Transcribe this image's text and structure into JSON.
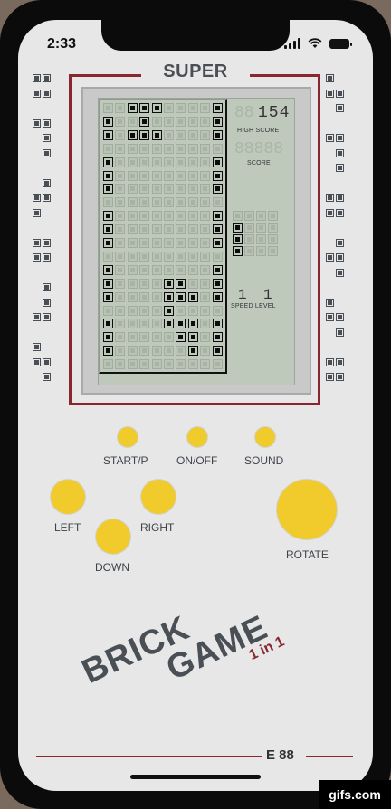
{
  "status": {
    "time": "2:33",
    "wifi_icon": "wifi-icon",
    "signal_icon": "signal-icon",
    "battery_icon": "battery-icon"
  },
  "console": {
    "title": "SUPER",
    "model": "E 88",
    "brand_top": "BRICK",
    "brand_bottom": "GAME",
    "brand_sub": "1 in 1"
  },
  "hud": {
    "high_score": "154",
    "high_score_label": "HIGH SCORE",
    "score": "",
    "score_label": "SCORE",
    "speed_digit": "1",
    "level_digit": "1",
    "speed_level_label": "SPEED LEVEL"
  },
  "board": {
    "cols": 10,
    "rows": 20,
    "on": [
      [
        0,
        2
      ],
      [
        0,
        3
      ],
      [
        0,
        4
      ],
      [
        0,
        9
      ],
      [
        1,
        0
      ],
      [
        1,
        3
      ],
      [
        1,
        9
      ],
      [
        2,
        0
      ],
      [
        2,
        2
      ],
      [
        2,
        3
      ],
      [
        2,
        4
      ],
      [
        2,
        9
      ],
      [
        4,
        0
      ],
      [
        4,
        9
      ],
      [
        5,
        0
      ],
      [
        5,
        9
      ],
      [
        6,
        0
      ],
      [
        6,
        9
      ],
      [
        8,
        0
      ],
      [
        8,
        9
      ],
      [
        9,
        0
      ],
      [
        9,
        9
      ],
      [
        10,
        0
      ],
      [
        10,
        9
      ],
      [
        12,
        0
      ],
      [
        12,
        9
      ],
      [
        13,
        0
      ],
      [
        13,
        6
      ],
      [
        13,
        9
      ],
      [
        14,
        0
      ],
      [
        14,
        5
      ],
      [
        14,
        6
      ],
      [
        14,
        7
      ],
      [
        14,
        9
      ],
      [
        16,
        0
      ],
      [
        16,
        5
      ],
      [
        16,
        6
      ],
      [
        16,
        7
      ],
      [
        16,
        9
      ],
      [
        17,
        0
      ],
      [
        17,
        6
      ],
      [
        17,
        7
      ],
      [
        17,
        9
      ],
      [
        18,
        0
      ],
      [
        18,
        7
      ],
      [
        18,
        9
      ],
      [
        13,
        5
      ],
      [
        15,
        5
      ]
    ]
  },
  "next_piece": {
    "on": [
      [
        1,
        0
      ],
      [
        2,
        0
      ],
      [
        3,
        0
      ]
    ]
  },
  "buttons": {
    "start": "START/P",
    "onoff": "ON/OFF",
    "sound": "SOUND",
    "left": "LEFT",
    "right": "RIGHT",
    "down": "DOWN",
    "rotate": "ROTATE"
  },
  "colors": {
    "accent_red": "#8a2630",
    "button_yellow": "#f1cb2b",
    "shell": "#e7e7e7",
    "lcd": "#bec9bb"
  },
  "watermark": "gifs.com"
}
